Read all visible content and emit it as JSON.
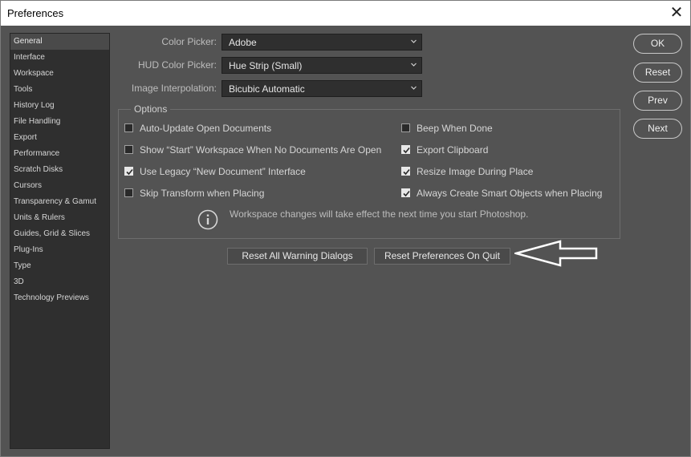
{
  "window": {
    "title": "Preferences",
    "close_glyph": "✕"
  },
  "sidebar": {
    "items": [
      {
        "label": "General",
        "selected": true
      },
      {
        "label": "Interface"
      },
      {
        "label": "Workspace"
      },
      {
        "label": "Tools"
      },
      {
        "label": "History Log"
      },
      {
        "label": "File Handling"
      },
      {
        "label": "Export"
      },
      {
        "label": "Performance"
      },
      {
        "label": "Scratch Disks"
      },
      {
        "label": "Cursors"
      },
      {
        "label": "Transparency & Gamut"
      },
      {
        "label": "Units & Rulers"
      },
      {
        "label": "Guides, Grid & Slices"
      },
      {
        "label": "Plug-Ins"
      },
      {
        "label": "Type"
      },
      {
        "label": "3D"
      },
      {
        "label": "Technology Previews"
      }
    ]
  },
  "fields": {
    "color_picker": {
      "label": "Color Picker:",
      "value": "Adobe"
    },
    "hud_color_picker": {
      "label": "HUD Color Picker:",
      "value": "Hue Strip (Small)"
    },
    "image_interpolation": {
      "label": "Image Interpolation:",
      "value": "Bicubic Automatic"
    }
  },
  "options": {
    "title": "Options",
    "items": [
      {
        "label": "Auto-Update Open Documents",
        "checked": false
      },
      {
        "label": "Beep When Done",
        "checked": false
      },
      {
        "label": "Show “Start” Workspace When No Documents Are Open",
        "checked": false
      },
      {
        "label": "Export Clipboard",
        "checked": true
      },
      {
        "label": "Use Legacy “New Document” Interface",
        "checked": true
      },
      {
        "label": "Resize Image During Place",
        "checked": true
      },
      {
        "label": "Skip Transform when Placing",
        "checked": false
      },
      {
        "label": "Always Create Smart Objects when Placing",
        "checked": true
      }
    ],
    "info_text": "Workspace changes will take effect the next time you start Photoshop."
  },
  "buttons": {
    "reset_warnings": "Reset All Warning Dialogs",
    "reset_prefs": "Reset Preferences On Quit",
    "ok": "OK",
    "reset": "Reset",
    "prev": "Prev",
    "next": "Next"
  },
  "colors": {
    "window_bg": "#535353",
    "sidebar_bg": "#2f2f2f",
    "dropdown_bg": "#2f2f2f",
    "titlebar_bg": "#ffffff"
  },
  "icons": {
    "info": "info-icon",
    "chevron": "chevron-down-icon",
    "arrow": "left-arrow-annotation-icon"
  }
}
